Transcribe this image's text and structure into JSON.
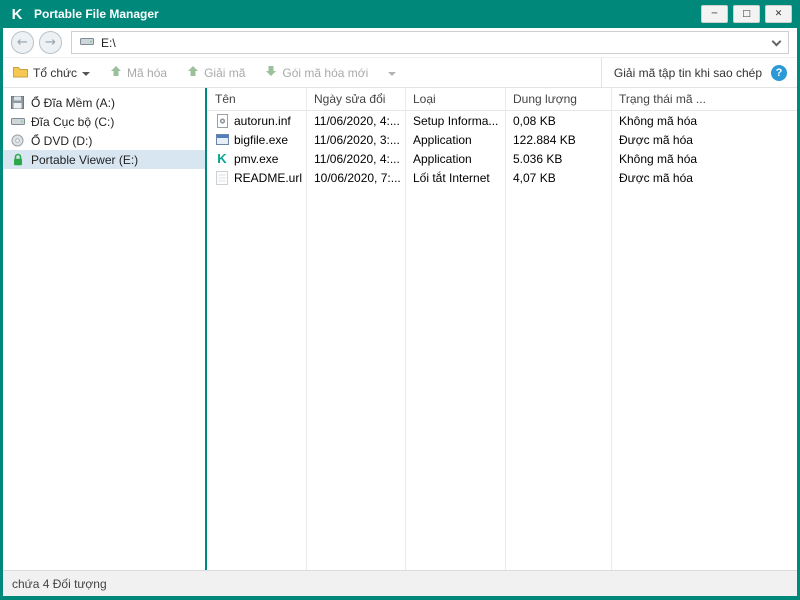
{
  "window": {
    "title": "Portable File Manager",
    "logo_glyph": "K"
  },
  "titlebar": {
    "minimize_label": "─",
    "maximize_label": "□",
    "close_label": "✕"
  },
  "navigation": {
    "back_glyph": "←",
    "forward_glyph": "→"
  },
  "address_bar": {
    "path": "E:\\"
  },
  "toolbar": {
    "organize_label": "Tổ chức",
    "encrypt_label": "Mã hóa",
    "decrypt_label": "Giải mã",
    "new_package_label": "Gói mã hóa mới",
    "decrypt_on_copy_label": "Giải mã tập tin khi sao chép",
    "help_label": "?"
  },
  "sidebar": {
    "items": [
      {
        "label": "Ổ Đĩa Mềm (A:)",
        "icon": "floppy-icon"
      },
      {
        "label": "Đĩa Cục bộ (C:)",
        "icon": "hdd-icon"
      },
      {
        "label": "Ổ DVD (D:)",
        "icon": "dvd-icon"
      },
      {
        "label": "Portable Viewer (E:)",
        "icon": "lock-icon",
        "selected": true
      }
    ]
  },
  "file_list": {
    "columns": {
      "name": "Tên",
      "modified": "Ngày sửa đổi",
      "type": "Loại",
      "size": "Dung lượng",
      "status": "Trạng thái mã ..."
    },
    "rows": [
      {
        "name": "autorun.inf",
        "modified": "11/06/2020, 4:...",
        "type": "Setup Informa...",
        "size": "0,08 KB",
        "status": "Không mã hóa",
        "icon": "setup-file-icon"
      },
      {
        "name": "bigfile.exe",
        "modified": "11/06/2020, 3:...",
        "type": "Application",
        "size": "122.884 KB",
        "status": "Được mã hóa",
        "icon": "application-icon"
      },
      {
        "name": "pmv.exe",
        "modified": "11/06/2020, 4:...",
        "type": "Application",
        "size": "5.036 KB",
        "status": "Không mã hóa",
        "icon": "kaspersky-app-icon",
        "icon_glyph": "K"
      },
      {
        "name": "README.url",
        "modified": "10/06/2020, 7:...",
        "type": "Lối tắt Internet",
        "size": "4,07 KB",
        "status": "Được mã hóa",
        "icon": "url-file-icon"
      }
    ]
  },
  "status_bar": {
    "text": "chứa 4 Đối tượng"
  },
  "colors": {
    "accent_teal": "#00897b",
    "selection": "#d8e6f2",
    "help_blue": "#2b99d6"
  }
}
